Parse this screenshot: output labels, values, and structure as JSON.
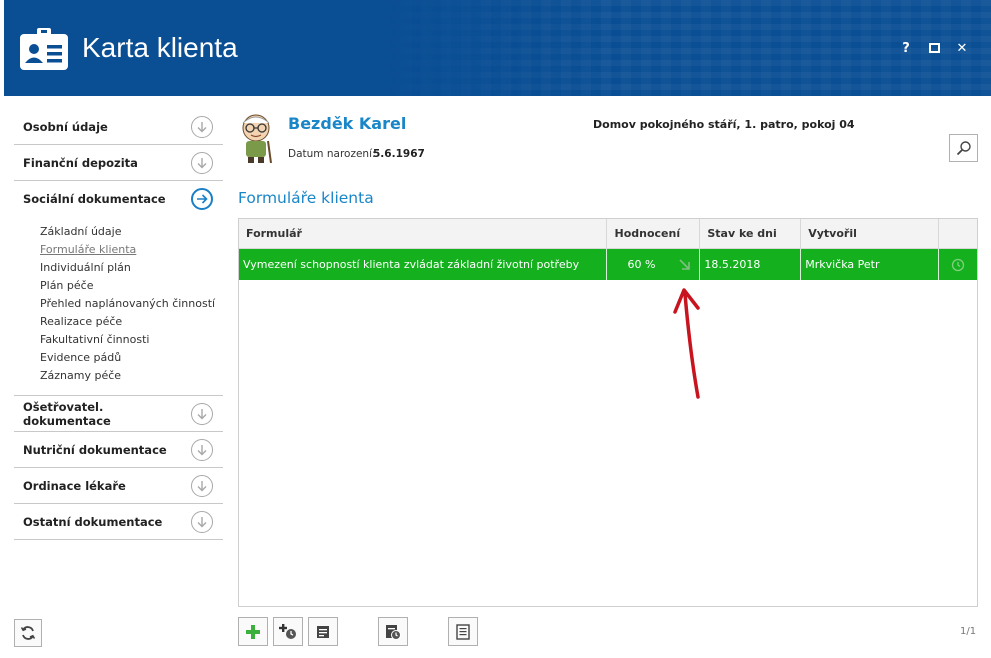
{
  "header": {
    "title": "Karta klienta",
    "controls": {
      "help": "?",
      "close": "✕"
    }
  },
  "sidebar": {
    "sections": [
      {
        "label": "Osobní údaje"
      },
      {
        "label": "Finanční depozita"
      },
      {
        "label": "Sociální dokumentace"
      },
      {
        "label": "Ošetřovatel. dokumentace"
      },
      {
        "label": "Nutriční dokumentace"
      },
      {
        "label": "Ordinace lékaře"
      },
      {
        "label": "Ostatní dokumentace"
      }
    ],
    "subitems": [
      "Základní údaje",
      "Formuláře klienta",
      "Individuální plán",
      "Plán péče",
      "Přehled naplánovaných činností",
      "Realizace péče",
      "Fakultativní činnosti",
      "Evidence pádů",
      "Záznamy péče"
    ]
  },
  "client": {
    "name": "Bezděk Karel",
    "dob_label": "Datum narození:",
    "dob": "5.6.1967",
    "location": "Domov pokojného stáří, 1. patro, pokoj 04"
  },
  "forms": {
    "title": "Formuláře klienta",
    "columns": [
      "Formulář",
      "Hodnocení",
      "Stav ke dni",
      "Vytvořil"
    ],
    "rows": [
      {
        "form": "Vymezení schopností klienta zvládat základní životní potřeby",
        "rating": "60 %",
        "date": "18.5.2018",
        "author": "Mrkvička Petr"
      }
    ]
  },
  "pager": "1/1",
  "colors": {
    "header": "#0a4e94",
    "accent": "#1a86c8",
    "row_highlight": "#15b01e",
    "annotation": "#c8141e"
  }
}
